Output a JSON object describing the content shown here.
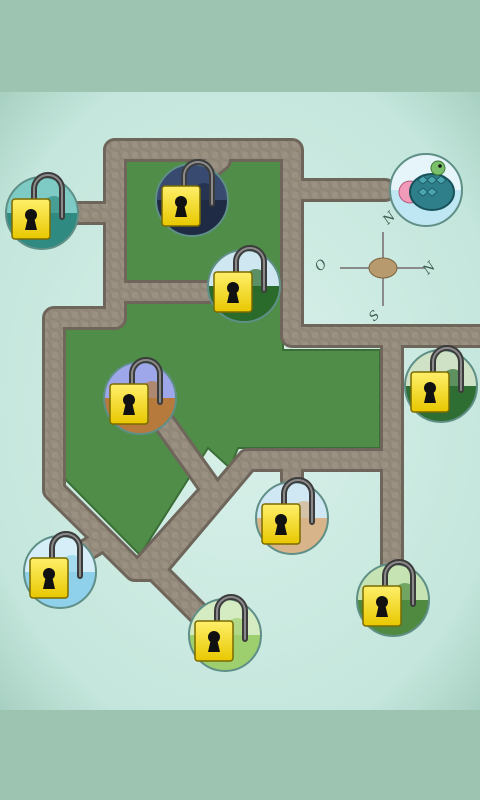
{
  "screen": "level-map",
  "colors": {
    "frame": "#9cc4b1",
    "board": "#cdebe3",
    "grass": "#4f8d48",
    "grass_dark": "#3b6e36",
    "path": "#8d8376",
    "path_edge": "#6f665b",
    "lock_body": "#f2dc1a",
    "lock_shackle": "#4a4a4a",
    "keyhole": "#111111"
  },
  "compass": {
    "labels": {
      "north": "N",
      "east": "N",
      "west": "O",
      "south": "S"
    }
  },
  "levels": [
    {
      "id": "parrot",
      "locked": true,
      "icon": "parrot-icon",
      "theme": "teal"
    },
    {
      "id": "night-scene",
      "locked": true,
      "icon": "moon-icon",
      "theme": "navy"
    },
    {
      "id": "hedgehog",
      "locked": true,
      "icon": "hedgehog-icon",
      "theme": "forest"
    },
    {
      "id": "turtle",
      "locked": false,
      "icon": "turtle-icon",
      "theme": "sky"
    },
    {
      "id": "meadow",
      "locked": true,
      "icon": "tree-icon",
      "theme": "meadow"
    },
    {
      "id": "beach",
      "locked": true,
      "icon": "crab-icon",
      "theme": "sand"
    },
    {
      "id": "desert",
      "locked": true,
      "icon": "camel-icon",
      "theme": "desert"
    },
    {
      "id": "water",
      "locked": true,
      "icon": "fish-icon",
      "theme": "water"
    },
    {
      "id": "frog",
      "locked": true,
      "icon": "frog-icon",
      "theme": "lime"
    },
    {
      "id": "jungle",
      "locked": true,
      "icon": "fern-icon",
      "theme": "jungle"
    }
  ]
}
